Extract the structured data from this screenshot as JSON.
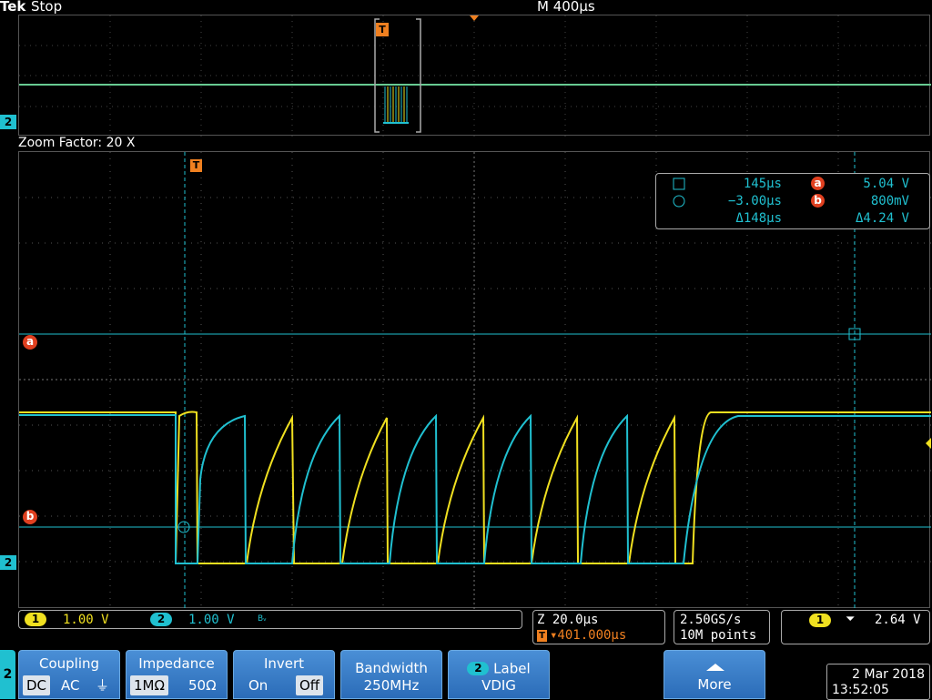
{
  "header": {
    "brand": "Tek",
    "state": "Stop",
    "timebase": "M 400µs"
  },
  "zoom_label": "Zoom Factor: 20 X",
  "markers": {
    "trigger": "T",
    "channel2": "2",
    "cursor_a": "a",
    "cursor_b": "b"
  },
  "readout": {
    "row1": {
      "time": "145µs",
      "volt_label": "a",
      "volt": "5.04 V"
    },
    "row2": {
      "time": "−3.00µs",
      "volt_label": "b",
      "volt": "800mV"
    },
    "row3": {
      "time": "Δ148µs",
      "volt": "Δ4.24 V"
    }
  },
  "status": {
    "ch1_num": "1",
    "ch1_scale": "1.00 V",
    "ch2_num": "2",
    "ch2_scale": "1.00 V",
    "bw_symbol": "Bᵥ",
    "zoom_scale": "Z 20.0µs",
    "trigger_pos": "▾401.000µs",
    "trig_T": "T",
    "sample_rate": "2.50GS/s",
    "record_length": "10M points",
    "trig_src": "1",
    "trig_slope": "⏷",
    "trig_level": "2.64 V"
  },
  "menu": {
    "channel_tab": "2",
    "coupling": {
      "title": "Coupling",
      "options": [
        "DC",
        "AC",
        "⏚"
      ],
      "selected": "DC"
    },
    "impedance": {
      "title": "Impedance",
      "options": [
        "1MΩ",
        "50Ω"
      ],
      "selected": "1MΩ"
    },
    "invert": {
      "title": "Invert",
      "options": [
        "On",
        "Off"
      ],
      "selected": "Off"
    },
    "bandwidth": {
      "title": "Bandwidth",
      "value": "250MHz"
    },
    "label": {
      "num": "2",
      "title": "Label",
      "value": "VDIG"
    },
    "more": {
      "title": "More"
    }
  },
  "datetime": {
    "date": "2 Mar 2018",
    "time": "13:52:05"
  },
  "colors": {
    "ch1": "#f0e020",
    "ch2": "#20c0d0",
    "marker_orange": "#f08020",
    "cursor_red": "#e04020",
    "menu_blue": "#3a7fcc",
    "grid": "#6a6a6a"
  }
}
